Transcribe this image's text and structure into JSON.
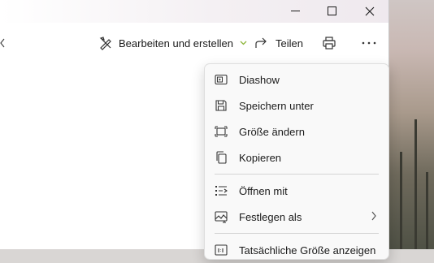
{
  "toolbar": {
    "edit_label": "Bearbeiten und erstellen",
    "share_label": "Teilen"
  },
  "menu": {
    "items": [
      {
        "label": "Diashow",
        "icon": "slideshow-icon"
      },
      {
        "label": "Speichern unter",
        "icon": "save-icon"
      },
      {
        "label": "Größe ändern",
        "icon": "resize-icon"
      },
      {
        "label": "Kopieren",
        "icon": "copy-icon"
      },
      {
        "label": "Öffnen mit",
        "icon": "open-with-icon"
      },
      {
        "label": "Festlegen als",
        "icon": "set-as-icon"
      },
      {
        "label": "Tatsächliche Größe anzeigen",
        "icon": "actual-size-icon"
      }
    ]
  },
  "colors": {
    "accent_chevron": "#8cb437",
    "menu_bg": "#f9f9f9"
  }
}
